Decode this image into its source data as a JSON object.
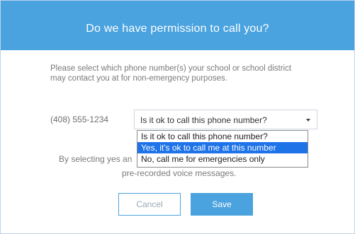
{
  "dialog": {
    "title": "Do we have permission to call you?",
    "intro": "Please select which phone number(s) your school or school district may contact you at for non-emergency purposes.",
    "phone_number": "(408) 555-1234",
    "select": {
      "selected_label": "Is it ok to call this phone number?",
      "options": [
        "Is it ok to call this phone number?",
        "Yes, it's ok to call me at this number",
        "No, call me for emergencies only"
      ],
      "highlighted_index": 1
    },
    "consent_line_1_prefix": "By selecting yes an",
    "consent_line_2": "pre-recorded voice messages.",
    "buttons": {
      "cancel": "Cancel",
      "save": "Save"
    }
  },
  "colors": {
    "header": "#4aa3df",
    "selected_option": "#1e73e8"
  }
}
